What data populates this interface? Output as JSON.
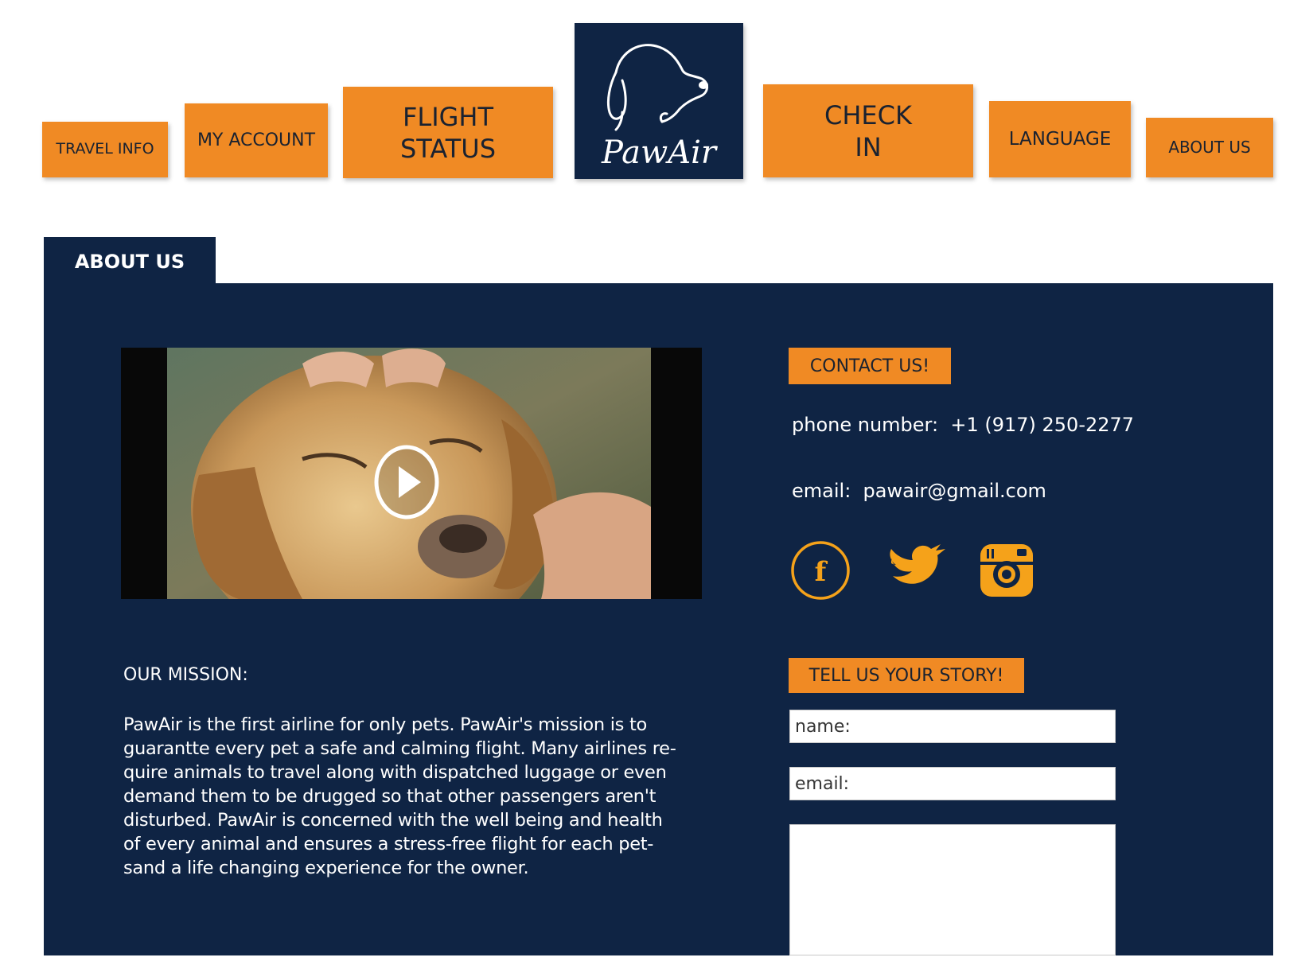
{
  "nav": {
    "travel_info": "TRAVEL INFO",
    "my_account": "MY ACCOUNT",
    "flight_status": "FLIGHT STATUS",
    "check_in": "CHECK IN",
    "language": "LANGUAGE",
    "about_us": "ABOUT US"
  },
  "logo": {
    "text": "PawAir"
  },
  "tab": {
    "label": "ABOUT US"
  },
  "video": {
    "icon": "play-icon"
  },
  "contact": {
    "heading": "CONTACT US!",
    "phone_label": "phone number:",
    "phone_value": "+1 (917) 250-2277",
    "email_label": "email:",
    "email_value": "pawair@gmail.com",
    "social": [
      "facebook-icon",
      "twitter-icon",
      "instagram-icon"
    ]
  },
  "mission": {
    "title": "OUR MISSION:",
    "lines": [
      "PawAir is the first airline for only pets. PawAir's mission is to",
      "guarantte every pet a safe and calming flight. Many airlines re-",
      "quire animals to travel along with dispatched luggage or even",
      "demand them to be drugged so that other passengers aren't",
      "disturbed. PawAir is concerned with the well being and health",
      "of every animal and ensures a stress-free flight for each pet-",
      "sand a life changing experience for the owner."
    ]
  },
  "story": {
    "heading": "TELL US YOUR STORY!",
    "name_placeholder": "name:",
    "email_placeholder": "email:"
  },
  "colors": {
    "navy": "#0f2444",
    "orange": "#f08a24",
    "icon_gold": "#f5a21a"
  }
}
